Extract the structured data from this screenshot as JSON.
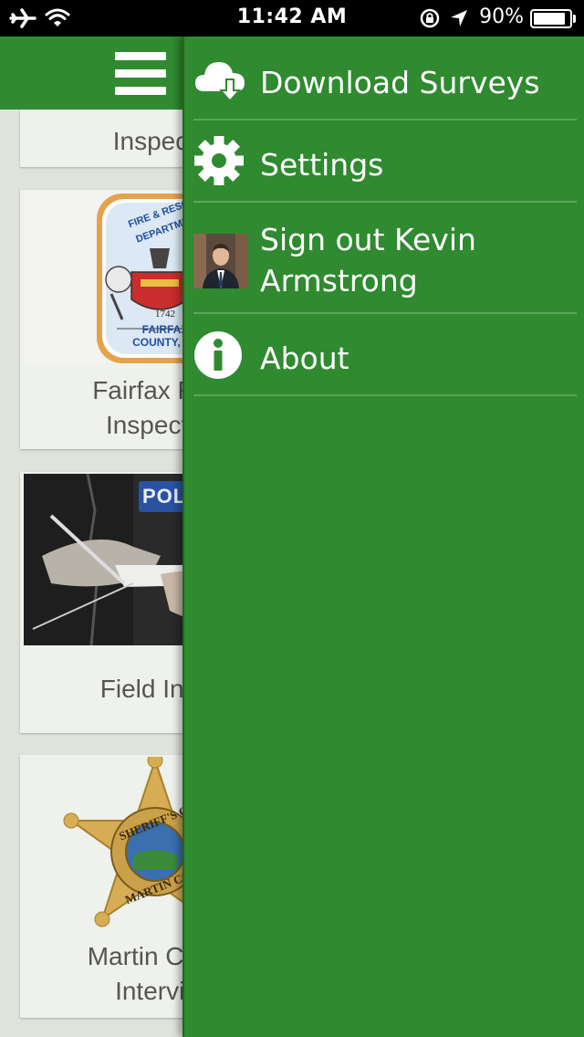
{
  "status_bar": {
    "time": "11:42 AM",
    "battery_percent": "90%",
    "battery_level": 0.9
  },
  "drawer": {
    "items": [
      {
        "label": "Download Surveys",
        "icon": "cloud-download-icon"
      },
      {
        "label": "Settings",
        "icon": "gear-icon"
      },
      {
        "label": "Sign out Kevin",
        "label2": "Armstrong",
        "icon": "user-avatar"
      },
      {
        "label": "About",
        "icon": "info-icon"
      }
    ]
  },
  "surveys": [
    {
      "title": "Inspecti"
    },
    {
      "title": "Fairfax Fire \nInspectio",
      "badge_line1": "FIRE & RESCUE",
      "badge_line2": "DEPARTMENT",
      "badge_year": "1742",
      "badge_name1": "FAIRFAX",
      "badge_name2": "COUNTY, VA"
    },
    {
      "title": "Field Inter",
      "patch_text": "POLI"
    },
    {
      "title": "Martin Coun\nIntervie",
      "seal_text1": "SHERIFF'S OFF",
      "seal_text2": "MARTIN COUN"
    }
  ]
}
